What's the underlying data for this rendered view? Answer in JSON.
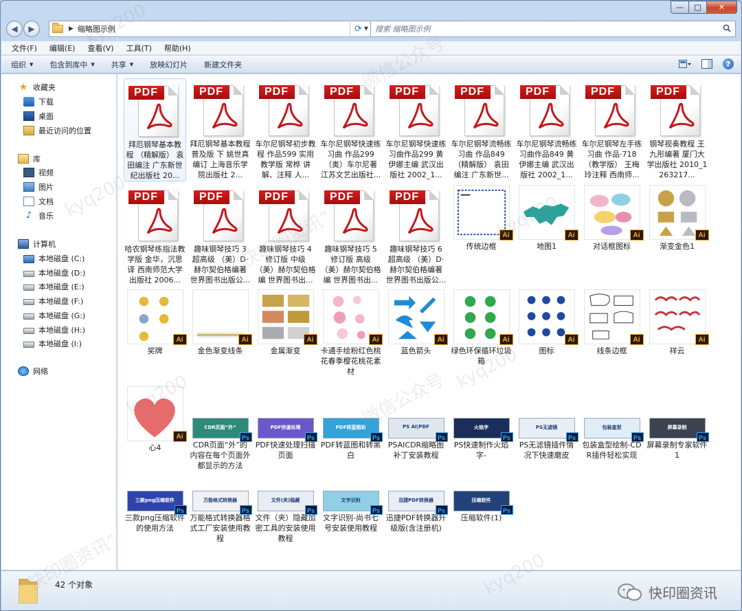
{
  "window": {
    "caption_buttons": {
      "minimize": "—",
      "maximize": "□",
      "close": "✕"
    }
  },
  "address": {
    "path": "缩略图示例",
    "search_placeholder": "搜索 缩略图示例"
  },
  "menu": [
    "文件(F)",
    "编辑(E)",
    "查看(V)",
    "工具(T)",
    "帮助(H)"
  ],
  "toolbar": {
    "organize": "组织",
    "include_library": "包含到库中",
    "share": "共享",
    "slideshow": "放映幻灯片",
    "new_folder": "新建文件夹"
  },
  "nav": {
    "favorites": "收藏夹",
    "favorites_items": [
      "下载",
      "桌面",
      "最近访问的位置"
    ],
    "libraries": "库",
    "library_items": [
      "视频",
      "图片",
      "文档",
      "音乐"
    ],
    "computer": "计算机",
    "drives": [
      "本地磁盘 (C:)",
      "本地磁盘 (D:)",
      "本地磁盘 (E:)",
      "本地磁盘 (F:)",
      "本地磁盘 (G:)",
      "本地磁盘 (H:)",
      "本地磁盘 (I:)"
    ],
    "network": "网络"
  },
  "files": [
    {
      "type": "pdf",
      "label": "拜厄钢琴基本教程 （精解版） 袁田编注 广东新世纪出版社 20..."
    },
    {
      "type": "pdf",
      "label": "拜厄钢琴基本教程 普及版 下 姚世真编订 上海音乐学院出版社 2..."
    },
    {
      "type": "pdf",
      "label": "车尔尼钢琴初步教程 作品599 实用教学版 常桦 讲解、注释 人..."
    },
    {
      "type": "pdf",
      "label": "车尔尼钢琴快速练习曲 作品299 （奥）车尔尼著 江苏文艺出版社..."
    },
    {
      "type": "pdf",
      "label": "车尔尼钢琴快速练习曲作品299 黄伊娜主编 武汉出版社 2002_1..."
    },
    {
      "type": "pdf",
      "label": "车尔尼钢琴流畅练习曲 作品849 （精解版） 袁田编注 广东新世..."
    },
    {
      "type": "pdf",
      "label": "车尔尼钢琴流畅练习曲作品849 黄伊娜主编 武汉出版社 2002_1..."
    },
    {
      "type": "pdf",
      "label": "车尔尼钢琴左手练习曲 作品·718 （教学版） 王梅玲注释 西南师..."
    },
    {
      "type": "pdf",
      "label": "钢琴视奏教程 王九彤编著 厦门大学出版社 2010_1263217..."
    },
    {
      "type": "pdf",
      "label": "哈农钢琴练指法教学版 金华，沉思译 西南师范大学出版社 2006..."
    },
    {
      "type": "pdf",
      "label": "趣味钢琴技巧 3 超高级 （美）D·赫尔契伯格编著 世界图书出版公..."
    },
    {
      "type": "pdf",
      "label": "趣味钢琴技巧 4 修订版 中级 （美）赫尔契伯格编 世界图书出..."
    },
    {
      "type": "pdf",
      "label": "趣味钢琴技巧 5 修订版 高级 （美）赫尔契伯格编 世界图书出..."
    },
    {
      "type": "pdf",
      "label": "趣味钢琴技巧 6 超高级 （美）D·赫尔契伯格编著 世界图书出版公..."
    },
    {
      "type": "ai",
      "art": "border",
      "label": "传统边框"
    },
    {
      "type": "ai",
      "art": "map",
      "label": "地图1"
    },
    {
      "type": "ai",
      "art": "bubbles",
      "label": "对话框图标"
    },
    {
      "type": "ai",
      "art": "gold",
      "label": "渐变金色1"
    },
    {
      "type": "ai",
      "art": "medals",
      "label": "奖牌"
    },
    {
      "type": "ai",
      "art": "goldline",
      "label": "金色渐变线条"
    },
    {
      "type": "ai",
      "art": "metal",
      "label": "金属渐变"
    },
    {
      "type": "ai",
      "art": "flowers",
      "label": "卡通手绘粉红色桃花春季樱花桃花素材"
    },
    {
      "type": "ai",
      "art": "arrows",
      "label": "蓝色箭头"
    },
    {
      "type": "ai",
      "art": "recycle",
      "label": "绿色环保循环垃圾箱"
    },
    {
      "type": "ai",
      "art": "icons",
      "label": "图标"
    },
    {
      "type": "ai",
      "art": "frames",
      "label": "线条边框"
    },
    {
      "type": "ai",
      "art": "clouds",
      "label": "祥云"
    },
    {
      "type": "ai",
      "art": "heart",
      "label": "心4"
    },
    {
      "type": "ps",
      "bg": "#2f8a7a",
      "txt": "CDR页面“外”",
      "label": "CDR页面“外”的内容在每个页面外都显示的方法"
    },
    {
      "type": "ps",
      "bg": "#6a58c9",
      "txt": "PDF快速处理",
      "label": "PDF快速处理扫描页面"
    },
    {
      "type": "ps",
      "bg": "#35a2d9",
      "txt": "PDF转蓝图和",
      "label": "PDF转蓝图和转黑白"
    },
    {
      "type": "ps",
      "bg": "#e0e6ee",
      "txt": "PS AI|PDF",
      "label": "PSAICDR缩略图补丁安装教程"
    },
    {
      "type": "ps",
      "bg": "#1b2d5a",
      "txt": "火焰字",
      "label": "PS快速制作火焰字-"
    },
    {
      "type": "ps",
      "bg": "#e8eef6",
      "txt": "PS无滤镜",
      "label": "PS无滤镜插件情况下快速磨皮"
    },
    {
      "type": "ps",
      "bg": "#e0ecf6",
      "txt": "包装盒型",
      "label": "包装盒型绘制-CDR插件轻松实现"
    },
    {
      "type": "ps",
      "bg": "#3b4250",
      "txt": "屏幕录制",
      "label": "屏幕录制专家软件1"
    },
    {
      "type": "ps",
      "bg": "#2e44a8",
      "txt": "三款png压缩软件",
      "label": "三款png压缩软件的使用方法"
    },
    {
      "type": "ps",
      "bg": "#f0f2f6",
      "txt": "万能格式转换器",
      "label": "万能格式转换器格式工厂安装使用教程"
    },
    {
      "type": "ps",
      "bg": "#e8ecf4",
      "txt": "文件(夹)隐藏",
      "label": "文件（夹）隐藏加密工具的安装使用教程"
    },
    {
      "type": "ps",
      "bg": "#8fd0e6",
      "txt": "文字识别",
      "label": "文字识别-尚书七号安装使用教程"
    },
    {
      "type": "ps",
      "bg": "#e9eef6",
      "txt": "迅捷PDF转换器",
      "label": "迅捷PDF转换器升级版(含注册机)"
    },
    {
      "type": "ps",
      "bg": "#24427a",
      "txt": "压缩软件",
      "label": "压缩软件(1)"
    }
  ],
  "status": {
    "count": "42 个对象",
    "brand": "快印圈资讯"
  },
  "colors": {
    "pdf_red": "#c4161c",
    "ai_badge_bg": "#2b1a08",
    "ai_badge_fg": "#f4a93a",
    "ps_badge_bg": "#061c3a",
    "ps_badge_fg": "#31a8ff"
  }
}
